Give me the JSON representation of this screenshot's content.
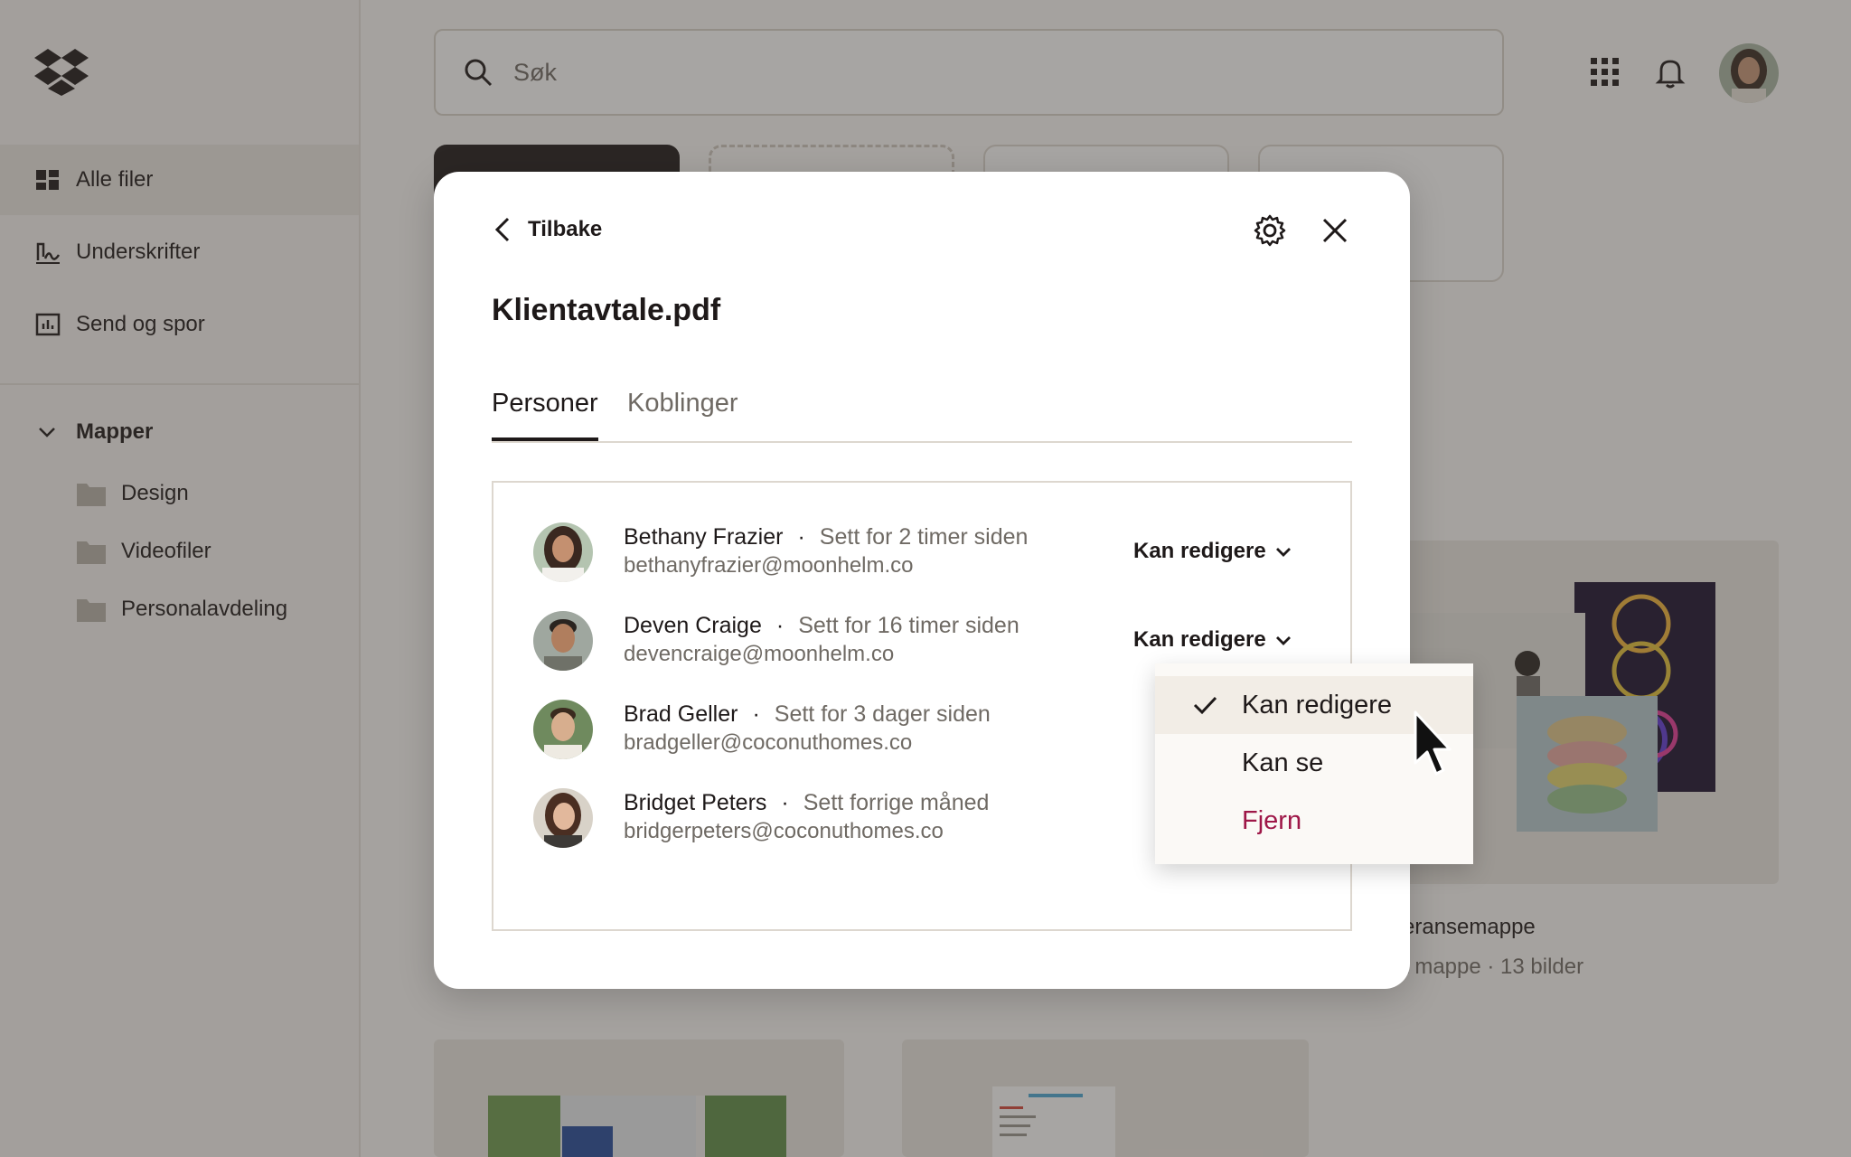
{
  "sidebar": {
    "nav": [
      {
        "label": "Alle filer",
        "icon": "all-files-icon",
        "active": true
      },
      {
        "label": "Underskrifter",
        "icon": "signature-icon",
        "active": false
      },
      {
        "label": "Send og spor",
        "icon": "chart-icon",
        "active": false
      }
    ],
    "folders_label": "Mapper",
    "folders": [
      "Design",
      "Videofiler",
      "Personalavdeling"
    ]
  },
  "search": {
    "placeholder": "Søk"
  },
  "background": {
    "gallery_title": "eransemappe",
    "gallery_sub": "t mappe · 13 bilder"
  },
  "modal": {
    "back_label": "Tilbake",
    "title": "Klientavtale.pdf",
    "tabs": [
      "Personer",
      "Koblinger"
    ],
    "people": [
      {
        "name": "Bethany Frazier",
        "seen": "Sett for 2 timer siden",
        "email": "bethanyfrazier@moonhelm.co",
        "permission": "Kan redigere"
      },
      {
        "name": "Deven Craige",
        "seen": "Sett for 16 timer siden",
        "email": "devencraige@moonhelm.co",
        "permission": "Kan redigere"
      },
      {
        "name": "Brad Geller",
        "seen": "Sett for 3 dager siden",
        "email": "bradgeller@coconuthomes.co",
        "permission": ""
      },
      {
        "name": "Bridget Peters",
        "seen": "Sett forrige måned",
        "email": "bridgerpeters@coconuthomes.co",
        "permission": ""
      }
    ],
    "separator": "·"
  },
  "menu": {
    "items": [
      {
        "label": "Kan redigere",
        "selected": true
      },
      {
        "label": "Kan se",
        "selected": false
      },
      {
        "label": "Fjern",
        "selected": false
      }
    ]
  },
  "colors": {
    "accent_dark": "#1e1919",
    "danger": "#9e1748",
    "muted": "#6f6a64"
  }
}
